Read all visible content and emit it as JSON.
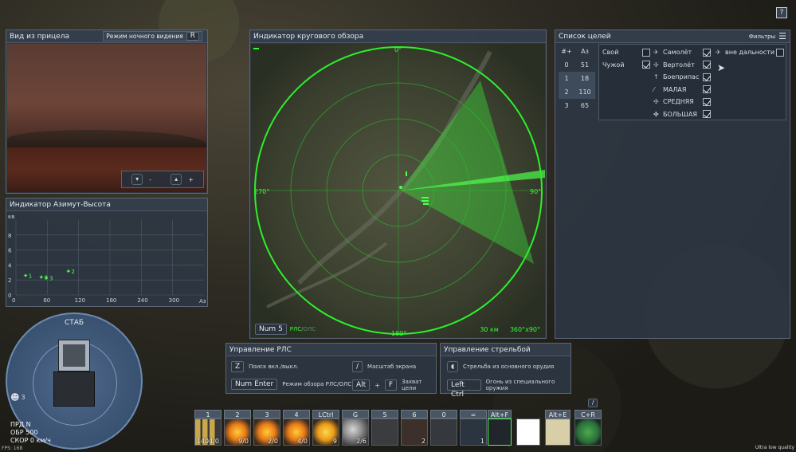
{
  "sight": {
    "title": "Вид из прицела",
    "night_label": "Режим ночного видения",
    "night_key": "R",
    "zoom_out": "-",
    "zoom_in": "+"
  },
  "az": {
    "title": "Индикатор Азимут-Высота",
    "ylabel": "кв",
    "xlabel": "Аз",
    "yticks": [
      "8",
      "6",
      "4",
      "2",
      "0"
    ],
    "xticks": [
      "0",
      "60",
      "120",
      "180",
      "240",
      "300"
    ]
  },
  "chart_data": {
    "type": "scatter",
    "xlabel": "Аз",
    "ylabel": "кв",
    "xlim": [
      0,
      360
    ],
    "ylim": [
      0,
      10
    ],
    "grid": true,
    "xticks": [
      0,
      60,
      120,
      180,
      240,
      300
    ],
    "yticks": [
      0,
      2,
      4,
      6,
      8
    ],
    "points": [
      {
        "label": "1",
        "x": 18,
        "y": 2.6
      },
      {
        "label": "0",
        "x": 48,
        "y": 2.4
      },
      {
        "label": "3",
        "x": 58,
        "y": 2.3
      },
      {
        "label": "2",
        "x": 100,
        "y": 3.2
      }
    ]
  },
  "radar": {
    "title": "Индикатор кругового обзора",
    "n": "0°",
    "e": "90°",
    "s": "180°",
    "w": "270°",
    "num_key": "Num 5",
    "mode_a": "РЛС",
    "mode_sep": "/",
    "mode_b": "ОЛС",
    "range": "30 км",
    "scan": "360°x90°"
  },
  "targets": {
    "title": "Список целей",
    "filters": "Фильтры",
    "header": {
      "num": "#+",
      "az": "Аз"
    },
    "rows": [
      {
        "num": "0",
        "az": "51"
      },
      {
        "num": "1",
        "az": "18"
      },
      {
        "num": "2",
        "az": "110"
      },
      {
        "num": "3",
        "az": "65"
      }
    ],
    "own": "Свой",
    "foreign": "Чужой",
    "types": [
      {
        "label": "Самолёт"
      },
      {
        "label": "Вертолёт"
      },
      {
        "label": "Боеприпас"
      },
      {
        "label": "МАЛАЯ"
      },
      {
        "label": "СРЕДНЯЯ"
      },
      {
        "label": "БОЛЬШАЯ"
      }
    ],
    "out_of_range": "вне дальности"
  },
  "stab": {
    "label": "СТАБ",
    "crew": "3",
    "line1": "ПРД N",
    "line2": "ОБР 500",
    "line3": "СКОР 0 км/ч"
  },
  "radar_ctrl": {
    "title": "Управление РЛС",
    "items": [
      {
        "key": "Z",
        "label": "Поиск вкл./выкл."
      },
      {
        "key": "/",
        "label": "Масштаб экрана"
      },
      {
        "key": "Num Enter",
        "label": "Режим обзора РЛС/ОЛС"
      },
      {
        "key_a": "Alt",
        "plus": "+",
        "key_b": "F",
        "label": "Захват цели"
      }
    ]
  },
  "fire_ctrl": {
    "title": "Управление стрельбой",
    "primary": "Стрельба из основного орудия",
    "secondary_key": "Left Ctrl",
    "secondary": "Огонь из специального оружия"
  },
  "weapons": [
    {
      "key": "1",
      "count": "1404/0"
    },
    {
      "key": "2",
      "count": "9/0"
    },
    {
      "key": "3",
      "count": "2/0"
    },
    {
      "key": "4",
      "count": "4/0"
    },
    {
      "key": "LCtrl",
      "count": "9"
    },
    {
      "key": "G",
      "count": "2/6"
    },
    {
      "key": "5",
      "count": ""
    },
    {
      "key": "6",
      "count": "2"
    },
    {
      "key": "0",
      "count": ""
    },
    {
      "key": "=",
      "count": "1"
    },
    {
      "key": "Alt+F",
      "count": ""
    },
    {
      "key": "",
      "count": ""
    },
    {
      "key": "Alt+E",
      "count": ""
    },
    {
      "key": "C+R",
      "count": ""
    }
  ],
  "weapon_extra": "/",
  "fps": "FPS: 168",
  "quality": "Ultra low quality",
  "help": "?"
}
